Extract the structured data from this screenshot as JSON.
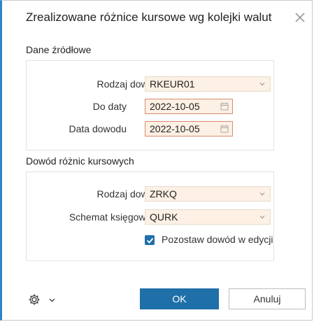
{
  "dialog": {
    "title": "Zrealizowane różnice kursowe wg kolejki walut"
  },
  "source": {
    "title": "Dane źródłowe",
    "doc_type_label": "Rodzaj dowodu",
    "doc_type_value": "RKEUR01",
    "to_date_label": "Do daty",
    "to_date_value": "2022-10-05",
    "doc_date_label": "Data dowodu",
    "doc_date_value": "2022-10-05"
  },
  "diff_doc": {
    "title": "Dowód różnic kursowych",
    "doc_type_label": "Rodzaj dowodu",
    "doc_type_value": "ZRKQ",
    "scheme_label": "Schemat księgowania",
    "scheme_value": "QURK",
    "keep_label": "Pozostaw dowód w edycji",
    "keep_checked": true
  },
  "footer": {
    "ok_label": "OK",
    "cancel_label": "Anuluj"
  },
  "colors": {
    "accent": "#1f6fa8",
    "field_bg": "#fdf0e4",
    "date_border": "#d98b70"
  },
  "icons": [
    "close-icon",
    "chevron-down-icon",
    "calendar-icon",
    "check-icon",
    "gear-icon"
  ]
}
